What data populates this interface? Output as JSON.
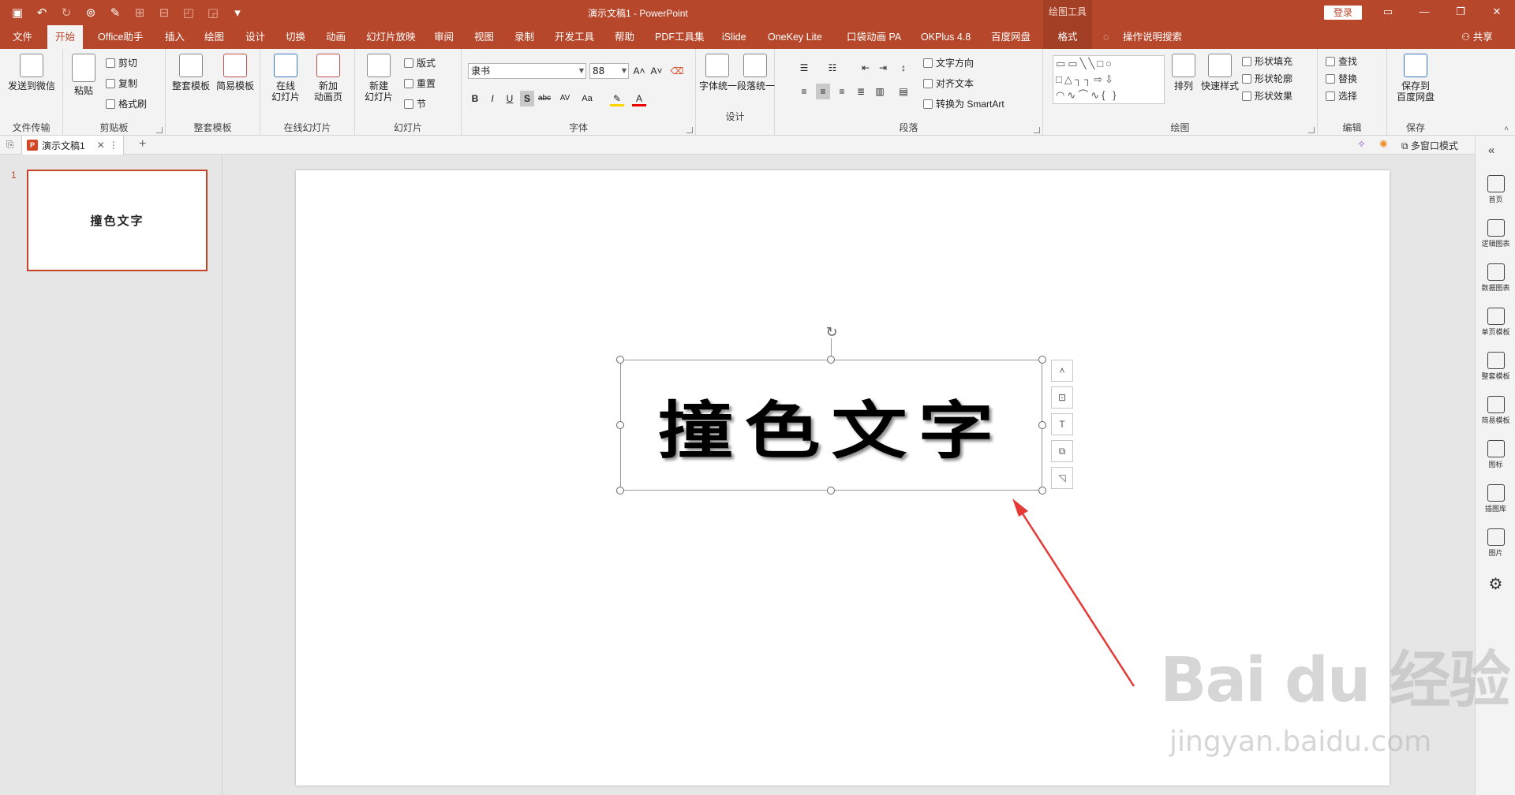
{
  "window": {
    "title": "演示文稿1 - PowerPoint",
    "context_title": "绘图工具",
    "login": "登录",
    "share": "共享"
  },
  "tabs": [
    {
      "label": "文件"
    },
    {
      "label": "开始"
    },
    {
      "label": "Office助手"
    },
    {
      "label": "插入"
    },
    {
      "label": "绘图"
    },
    {
      "label": "设计"
    },
    {
      "label": "切换"
    },
    {
      "label": "动画"
    },
    {
      "label": "幻灯片放映"
    },
    {
      "label": "审阅"
    },
    {
      "label": "视图"
    },
    {
      "label": "录制"
    },
    {
      "label": "开发工具"
    },
    {
      "label": "帮助"
    },
    {
      "label": "PDF工具集"
    },
    {
      "label": "iSlide"
    },
    {
      "label": "OneKey Lite"
    },
    {
      "label": "口袋动画 PA"
    },
    {
      "label": "OKPlus 4.8"
    },
    {
      "label": "百度网盘"
    },
    {
      "label": "格式"
    },
    {
      "label": "操作说明搜索"
    }
  ],
  "ribbon": {
    "g1": {
      "label": "文件传输",
      "btn": "发送到微信"
    },
    "g2": {
      "label": "剪贴板",
      "paste": "粘贴",
      "cut": "剪切",
      "copy": "复制",
      "painter": "格式刷"
    },
    "g3": {
      "label": "整套模板",
      "b1": "整套模板",
      "b2": "简易模板"
    },
    "g4": {
      "label": "在线幻灯片",
      "b1a": "在线",
      "b1b": "幻灯片",
      "b2a": "新加",
      "b2b": "动画页"
    },
    "g5": {
      "label": "幻灯片",
      "newa": "新建",
      "newb": "幻灯片",
      "layout": "版式",
      "reset": "重置",
      "section": "节"
    },
    "g6": {
      "label": "字体",
      "font": "隶书",
      "size": "88"
    },
    "g7": {
      "label": "设计",
      "b1": "字体统一",
      "b2": "段落统一"
    },
    "g8": {
      "label": "段落",
      "dir": "文字方向",
      "align": "对齐文本",
      "smart": "转换为 SmartArt"
    },
    "g9": {
      "label": "绘图",
      "arrange": "排列",
      "quick": "快速样式",
      "fill": "形状填充",
      "outline": "形状轮廓",
      "effect": "形状效果"
    },
    "g10": {
      "label": "编辑",
      "find": "查找",
      "replace": "替换",
      "select": "选择"
    },
    "g11": {
      "label": "保存",
      "b1a": "保存到",
      "b1b": "百度网盘"
    }
  },
  "doc_tab": {
    "name": "演示文稿1",
    "multi": "多窗口模式"
  },
  "slides": [
    {
      "number": "1",
      "text": "撞色文字"
    }
  ],
  "slide": {
    "text": "撞色文字"
  },
  "right_panel": [
    "首页",
    "逻辑图表",
    "数据图表",
    "单页模板",
    "整套模板",
    "简易模板",
    "图标",
    "插图库",
    "图片"
  ],
  "watermark": {
    "main": "Bai du 经验",
    "sub": "jingyan.baidu.com"
  },
  "colors": {
    "accent": "#b7472a",
    "selection": "#c5432a",
    "arrow": "#e53935"
  }
}
